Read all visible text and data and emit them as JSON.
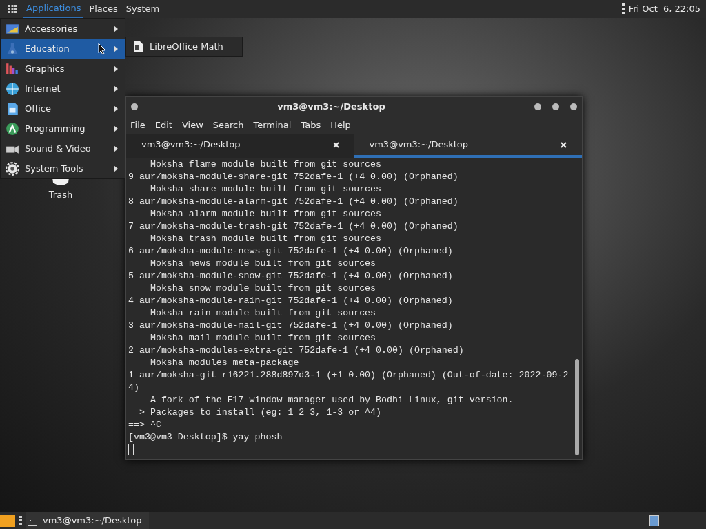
{
  "top_panel": {
    "menus": [
      {
        "label": "Applications",
        "selected": true
      },
      {
        "label": "Places",
        "selected": false
      },
      {
        "label": "System",
        "selected": false
      }
    ],
    "clock": "Fri Oct  6, 22:05"
  },
  "app_menu": {
    "items": [
      {
        "label": "Accessories",
        "selected": false,
        "color": "#4a7fd6"
      },
      {
        "label": "Education",
        "selected": true,
        "color": "#3b6fb8"
      },
      {
        "label": "Graphics",
        "selected": false,
        "color": "#e0565b"
      },
      {
        "label": "Internet",
        "selected": false,
        "color": "#3aa0d8"
      },
      {
        "label": "Office",
        "selected": false,
        "color": "#5aa8e8"
      },
      {
        "label": "Programming",
        "selected": false,
        "color": "#3b9c5a"
      },
      {
        "label": "Sound & Video",
        "selected": false,
        "color": "#cccccc"
      },
      {
        "label": "System Tools",
        "selected": false,
        "color": "#e8e8e8"
      }
    ],
    "submenu": [
      "LibreOffice Math"
    ]
  },
  "desktop": {
    "icons": [
      {
        "label": "Trash"
      }
    ]
  },
  "terminal": {
    "title": "vm3@vm3:~/Desktop",
    "menus": [
      "File",
      "Edit",
      "View",
      "Search",
      "Terminal",
      "Tabs",
      "Help"
    ],
    "tabs": [
      {
        "label": "vm3@vm3:~/Desktop",
        "selected": false
      },
      {
        "label": "vm3@vm3:~/Desktop",
        "selected": true
      }
    ],
    "lines": [
      "    Moksha flame module built from git sources",
      "9 aur/moksha-module-share-git 752dafe-1 (+4 0.00) (Orphaned)",
      "    Moksha share module built from git sources",
      "8 aur/moksha-module-alarm-git 752dafe-1 (+4 0.00) (Orphaned)",
      "    Moksha alarm module built from git sources",
      "7 aur/moksha-module-trash-git 752dafe-1 (+4 0.00) (Orphaned)",
      "    Moksha trash module built from git sources",
      "6 aur/moksha-module-news-git 752dafe-1 (+4 0.00) (Orphaned)",
      "    Moksha news module built from git sources",
      "5 aur/moksha-module-snow-git 752dafe-1 (+4 0.00) (Orphaned)",
      "    Moksha snow module built from git sources",
      "4 aur/moksha-module-rain-git 752dafe-1 (+4 0.00) (Orphaned)",
      "    Moksha rain module built from git sources",
      "3 aur/moksha-module-mail-git 752dafe-1 (+4 0.00) (Orphaned)",
      "    Moksha mail module built from git sources",
      "2 aur/moksha-modules-extra-git 752dafe-1 (+4 0.00) (Orphaned)",
      "    Moksha modules meta-package",
      "1 aur/moksha-git r16221.288d897d3-1 (+1 0.00) (Orphaned) (Out-of-date: 2022-09-2",
      "4)",
      "    A fork of the E17 window manager used by Bodhi Linux, git version.",
      "==> Packages to install (eg: 1 2 3, 1-3 or ^4)",
      "==> ^C",
      "[vm3@vm3 Desktop]$ yay phosh"
    ]
  },
  "taskbar": {
    "tasks": [
      {
        "label": "vm3@vm3:~/Desktop"
      }
    ]
  }
}
